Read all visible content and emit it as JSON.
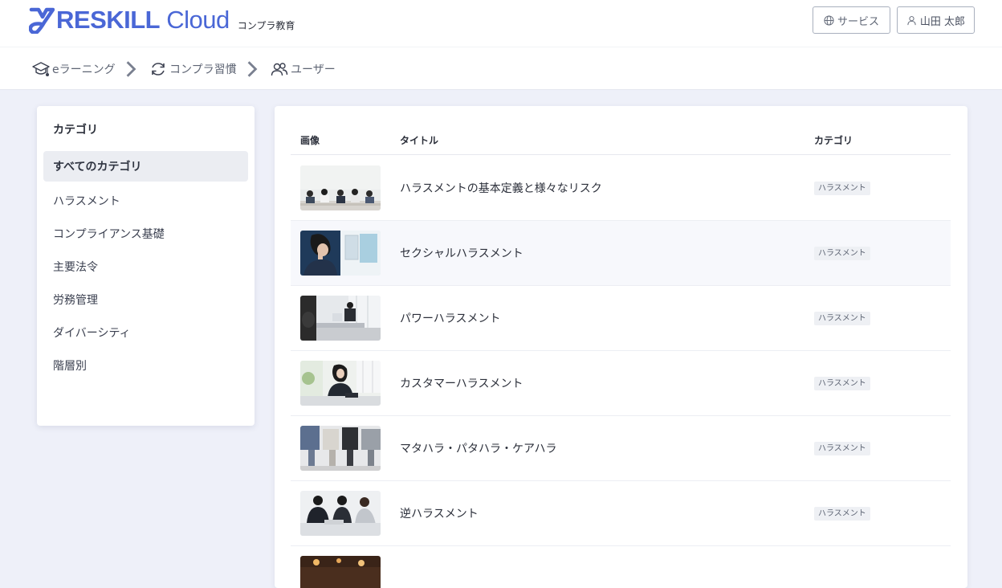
{
  "header": {
    "logo_text": "RESKILL",
    "logo_cloud": " Cloud",
    "logo_sub": "コンプラ教育",
    "service_button": "サービス",
    "user_button": "山田 太郎"
  },
  "nav": {
    "items": [
      {
        "label": "eラーニング",
        "icon": "graduation-cap-icon"
      },
      {
        "label": "コンプラ習慣",
        "icon": "refresh-cycle-icon"
      },
      {
        "label": "ユーザー",
        "icon": "users-icon"
      }
    ]
  },
  "sidebar": {
    "title": "カテゴリ",
    "items": [
      {
        "label": "すべてのカテゴリ",
        "active": true
      },
      {
        "label": "ハラスメント"
      },
      {
        "label": "コンプライアンス基礎"
      },
      {
        "label": "主要法令"
      },
      {
        "label": "労務管理"
      },
      {
        "label": "ダイバーシティ"
      },
      {
        "label": "階層別"
      }
    ]
  },
  "table": {
    "headers": {
      "image": "画像",
      "title": "タイトル",
      "category": "カテゴリ"
    },
    "rows": [
      {
        "title": "ハラスメントの基本定義と様々なリスク",
        "category": "ハラスメント",
        "image": "meeting-table-photo"
      },
      {
        "title": "セクシャルハラスメント",
        "category": "ハラスメント",
        "image": "distressed-woman-photo"
      },
      {
        "title": "パワーハラスメント",
        "category": "ハラスメント",
        "image": "office-scolding-photo"
      },
      {
        "title": "カスタマーハラスメント",
        "category": "ハラスメント",
        "image": "phone-call-photo"
      },
      {
        "title": "マタハラ・パタハラ・ケアハラ",
        "category": "ハラスメント",
        "image": "seated-group-photo"
      },
      {
        "title": "逆ハラスメント",
        "category": "ハラスメント",
        "image": "business-discussion-photo"
      },
      {
        "title": "",
        "category": "",
        "image": "partial-photo"
      }
    ]
  },
  "colors": {
    "brand": "#4a67d6",
    "page_bg": "#eef0f9",
    "row_highlight": "#f7f8fc"
  }
}
